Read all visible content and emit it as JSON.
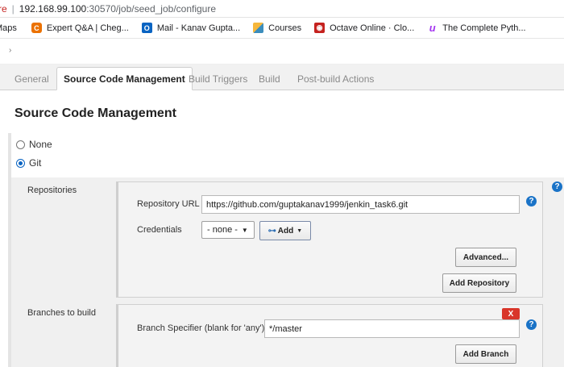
{
  "address_bar": {
    "scheme_fragment": "re",
    "host": "192.168.99.100",
    "path": ":30570/job/seed_job/configure"
  },
  "bookmarks": [
    {
      "label": "Maps",
      "icon": "maps-icon"
    },
    {
      "label": "Expert Q&A | Cheg...",
      "icon": "chegg-icon"
    },
    {
      "label": "Mail - Kanav Gupta...",
      "icon": "outlook-icon"
    },
    {
      "label": "Courses",
      "icon": "courses-icon"
    },
    {
      "label": "Octave Online · Clo...",
      "icon": "octave-icon"
    },
    {
      "label": "The Complete Pyth...",
      "icon": "udemy-icon"
    }
  ],
  "tabs": [
    {
      "label": "General",
      "active": false
    },
    {
      "label": "Source Code Management",
      "active": true
    },
    {
      "label": "Build Triggers",
      "active": false
    },
    {
      "label": "Build",
      "active": false
    },
    {
      "label": "Post-build Actions",
      "active": false
    }
  ],
  "scm": {
    "title": "Source Code Management",
    "options": [
      {
        "label": "None",
        "checked": false
      },
      {
        "label": "Git",
        "checked": true
      }
    ]
  },
  "repositories": {
    "label": "Repositories",
    "url_label": "Repository URL",
    "url_value": "https://github.com/guptakanav1999/jenkin_task6.git",
    "credentials_label": "Credentials",
    "credentials_value": "- none -",
    "add_label": "Add",
    "advanced_label": "Advanced...",
    "add_repo_label": "Add Repository"
  },
  "branches": {
    "label": "Branches to build",
    "specifier_label": "Branch Specifier (blank for 'any')",
    "specifier_value": "*/master",
    "delete_label": "X",
    "add_branch_label": "Add Branch"
  },
  "help_glyph": "?",
  "colors": {
    "accent": "#1a73c7",
    "danger": "#d9362a"
  }
}
